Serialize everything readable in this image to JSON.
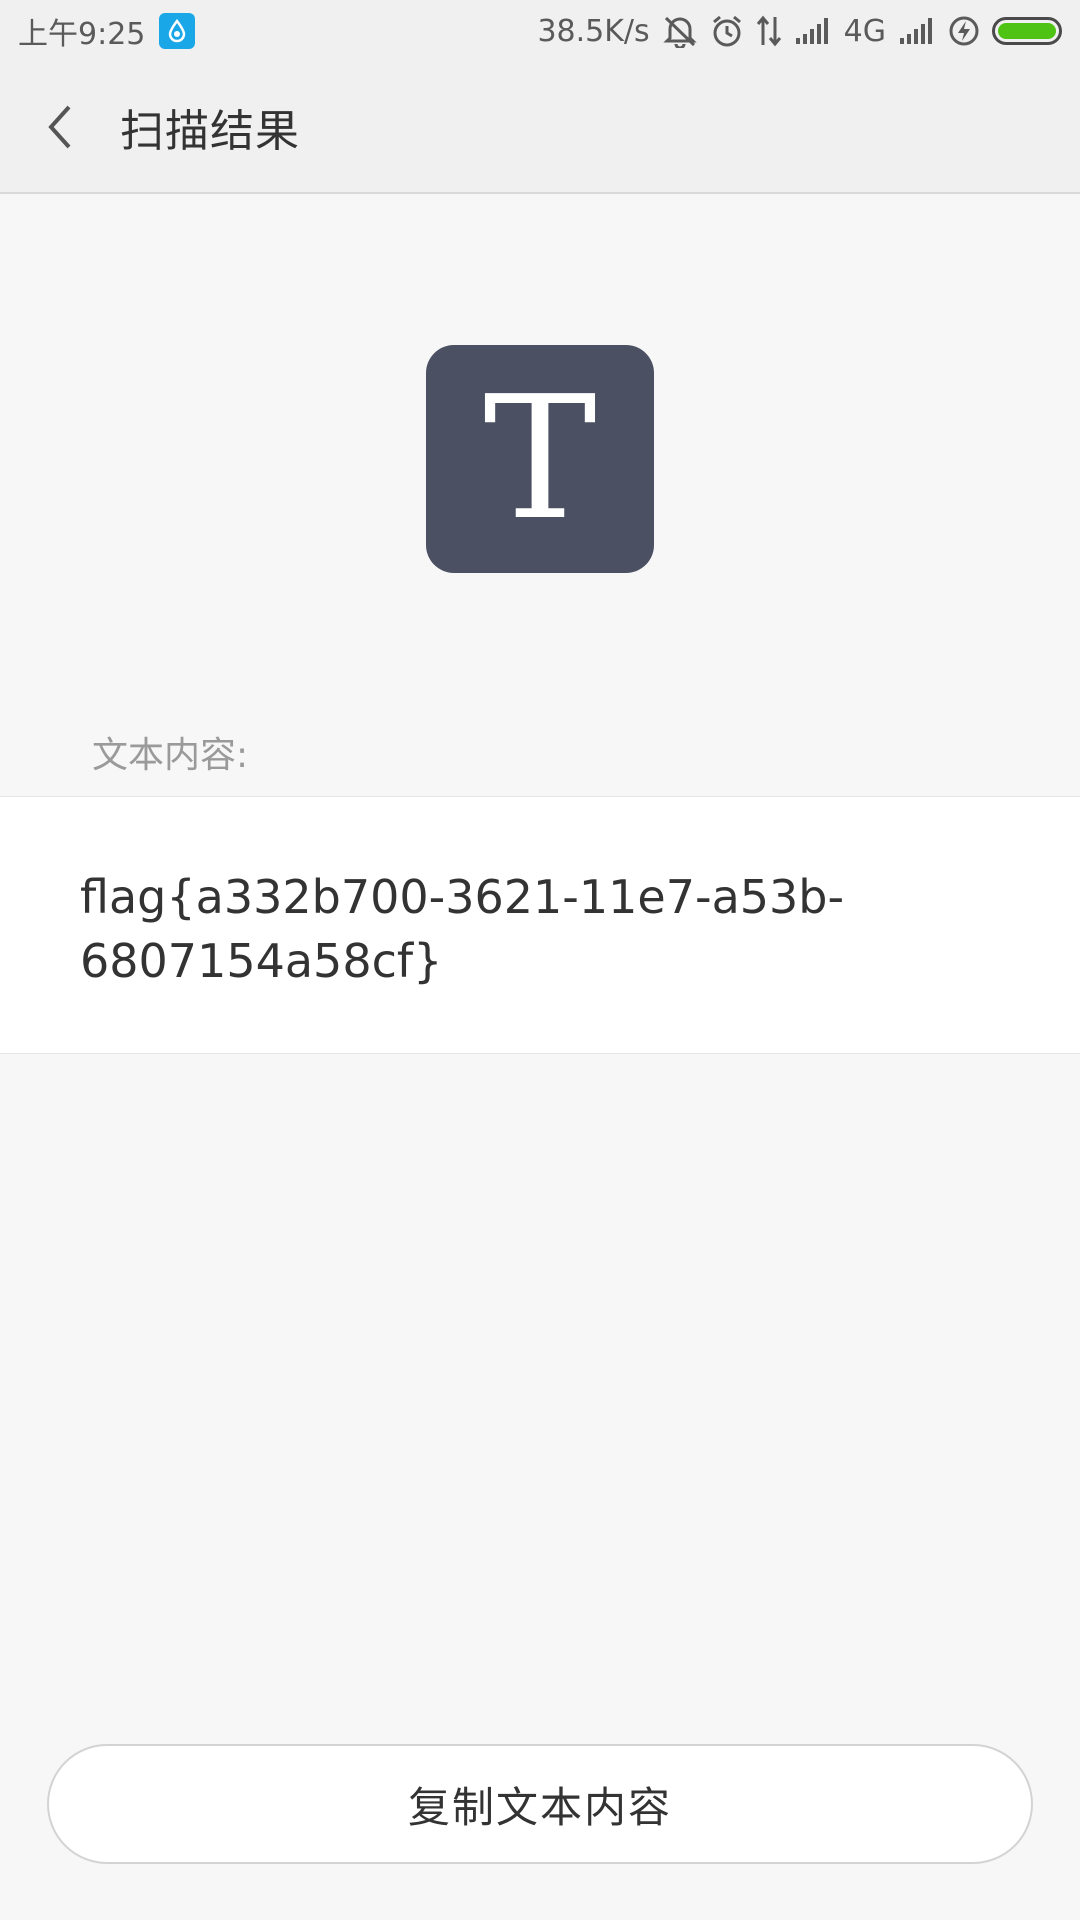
{
  "status_bar": {
    "time": "上午9:25",
    "network_speed": "38.5K/s",
    "network_type": "4G",
    "icons": [
      "app-notification-icon",
      "mute-icon",
      "alarm-icon",
      "data-transfer-icon",
      "signal-icon",
      "signal-icon-2",
      "charging-icon",
      "battery-icon"
    ],
    "battery_level_percent": 100,
    "battery_color": "#4fc314"
  },
  "header": {
    "title": "扫描结果",
    "back_icon": "chevron-left-icon"
  },
  "result": {
    "type_icon_letter": "T",
    "type_icon_color": "#4b5063",
    "label": "文本内容:",
    "text": "flag{a332b700-3621-11e7-a53b-6807154a58cf}"
  },
  "actions": {
    "copy_label": "复制文本内容"
  }
}
